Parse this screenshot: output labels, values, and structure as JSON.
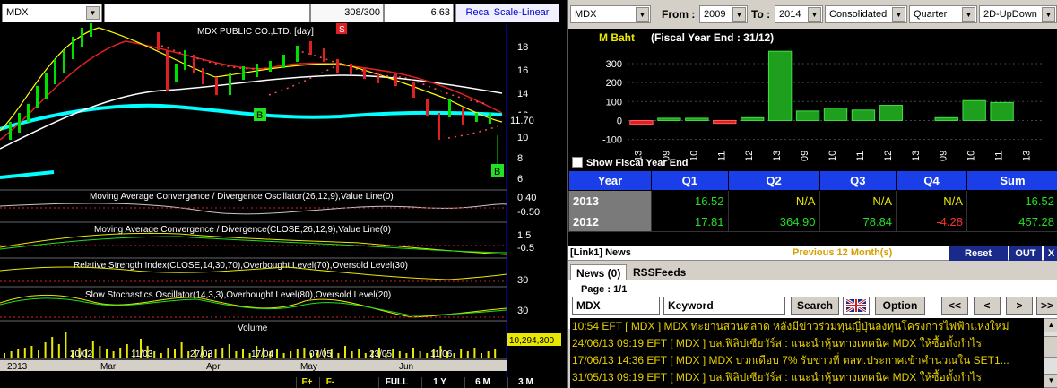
{
  "toolbar": {
    "symbol": "MDX",
    "count": "308/300",
    "last_price": "6.63",
    "recal": "Recal Scale-Linear"
  },
  "chart": {
    "title": "MDX PUBLIC CO.,LTD. [day]",
    "price_axis": [
      "18",
      "16",
      "14",
      "12",
      "10",
      "8",
      "6"
    ],
    "last_price_label": "11.70",
    "signal_sell": "S",
    "signal_buy": "B",
    "indicators": [
      {
        "title": "Moving Average Convergence / Divergence Oscillator(26,12,9),Value Line(0)",
        "axis": [
          "0.40",
          "-0.50"
        ]
      },
      {
        "title": "Moving Average Convergence / Divergence(CLOSE,26,12,9),Value Line(0)",
        "axis": [
          "1.5",
          "-0.5"
        ]
      },
      {
        "title": "Relative Strength Index(CLOSE,14,30,70),Overbought Level(70),Oversold Level(30)",
        "axis": [
          "30"
        ]
      },
      {
        "title": "Slow Stochastics Oscillator(14,3,3),Overbought Level(80),Oversold Level(20)",
        "axis": [
          "30"
        ]
      }
    ],
    "volume_title": "Volume",
    "volume_label": "10,294,300",
    "date_axis": [
      "2013",
      "20/02",
      "Mar",
      "11/03",
      "27/03",
      "Apr",
      "17/04",
      "May",
      "07/05",
      "23/05",
      "Jun",
      "11/06"
    ],
    "bottom_tabs": [
      "F+",
      "F-",
      "FULL",
      "1 Y",
      "6 M",
      "3 M"
    ]
  },
  "filters": {
    "symbol": "MDX",
    "from_label": "From :",
    "from_value": "2009",
    "to_label": "To :",
    "to_value": "2014",
    "consolidated": "Consolidated",
    "period": "Quarter",
    "mode": "2D-UpDown"
  },
  "bar_chart": {
    "title": "M Baht",
    "subtitle": "(Fiscal Year End : 31/12)",
    "y_ticks": [
      "300",
      "200",
      "100",
      "0",
      "-100"
    ],
    "x_labels": [
      "13",
      "09",
      "10",
      "11",
      "12",
      "13",
      "09",
      "10",
      "11",
      "12",
      "13",
      "09",
      "10",
      "11",
      "13"
    ]
  },
  "chart_data": {
    "type": "bar",
    "categories": [
      "13",
      "09",
      "10",
      "11",
      "12",
      "13",
      "09",
      "10",
      "11",
      "12",
      "13",
      "09",
      "10",
      "11",
      "13"
    ],
    "values": [
      -20,
      12,
      12,
      -15,
      15,
      365,
      50,
      65,
      55,
      80,
      0,
      15,
      105,
      95,
      0
    ],
    "ylim": [
      -130,
      380
    ]
  },
  "show_fy_label": "Show Fiscal Year End",
  "fin_table": {
    "headers": [
      "Year",
      "Q1",
      "Q2",
      "Q3",
      "Q4",
      "Sum"
    ],
    "rows": [
      {
        "year": "2013",
        "q1": "16.52",
        "q2": "N/A",
        "q3": "N/A",
        "q4": "N/A",
        "sum": "16.52"
      },
      {
        "year": "2012",
        "q1": "17.81",
        "q2": "364.90",
        "q3": "78.84",
        "q4": "-4.28",
        "sum": "457.28"
      }
    ]
  },
  "news": {
    "panel_title": "[Link1] News",
    "prev_label": "Previous 12 Month(s)",
    "reset": "Reset",
    "out": "OUT",
    "x": "X",
    "tabs": [
      "News (0)",
      "RSSFeeds"
    ],
    "page_label": "Page : 1/1",
    "symbol_value": "MDX",
    "keyword_placeholder": "Keyword",
    "search_btn": "Search",
    "option_btn": "Option",
    "nav": [
      "<<",
      "<",
      ">",
      ">>"
    ],
    "items": [
      "10:54  EFT  [ MDX ]  MDX ทะยานสวนตลาด หลังมีข่าวร่วมทุนญี่ปุ่นลงทุนโครงการไฟฟ้าแห่งใหม่",
      "24/06/13 09:19  EFT  [ MDX ]  บล.ฟิลิปเซียวัร์ส : แนะนำหุ้นทางเทคนิค MDX ให้ซื้อตั้งกำไร",
      "17/06/13 14:36  EFT  [ MDX ]  MDX บวกเดือบ 7% รับข่าวที่ ตลท.ประกาศเข้าคำนวณใน SET1...",
      "31/05/13 09:19  EFT  [ MDX ]  บล.ฟิลิปเซียวัร์ส : แนะนำหุ้นทางเทคนิค MDX ให้ซื้อตั้งกำไร"
    ]
  }
}
